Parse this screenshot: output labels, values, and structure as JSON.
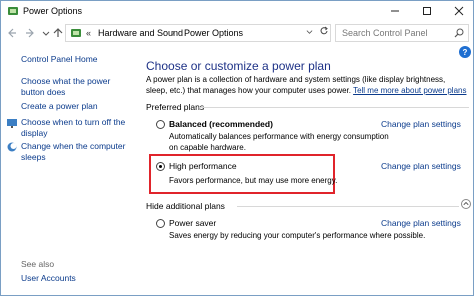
{
  "window": {
    "title": "Power Options"
  },
  "address": {
    "sep0": "«",
    "crumbs": [
      "Hardware and Sound",
      "Power Options"
    ],
    "sep": "›",
    "search_placeholder": "Search Control Panel"
  },
  "leftnav": {
    "home": "Control Panel Home",
    "items": [
      "Choose what the power button does",
      "Create a power plan",
      "Choose when to turn off the display",
      "Change when the computer sleeps"
    ],
    "see_also_label": "See also",
    "user_accounts": "User Accounts"
  },
  "main": {
    "heading": "Choose or customize a power plan",
    "intro_text": "A power plan is a collection of hardware and system settings (like display brightness, sleep, etc.) that manages how your computer uses power. ",
    "intro_link": "Tell me more about power plans",
    "preferred_label": "Preferred plans",
    "hide_label": "Hide additional plans",
    "plans": [
      {
        "name": "Balanced (recommended)",
        "desc": "Automatically balances performance with energy consumption on capable hardware.",
        "link": "Change plan settings",
        "selected": false
      },
      {
        "name": "High performance",
        "desc": "Favors performance, but may use more energy.",
        "link": "Change plan settings",
        "selected": true
      },
      {
        "name": "Power saver",
        "desc": "Saves energy by reducing your computer's performance where possible.",
        "link": "Change plan settings",
        "selected": false
      }
    ]
  },
  "colors": {
    "link": "#0b3b8c",
    "heading": "#1e3287",
    "highlight": "#e0242b"
  }
}
